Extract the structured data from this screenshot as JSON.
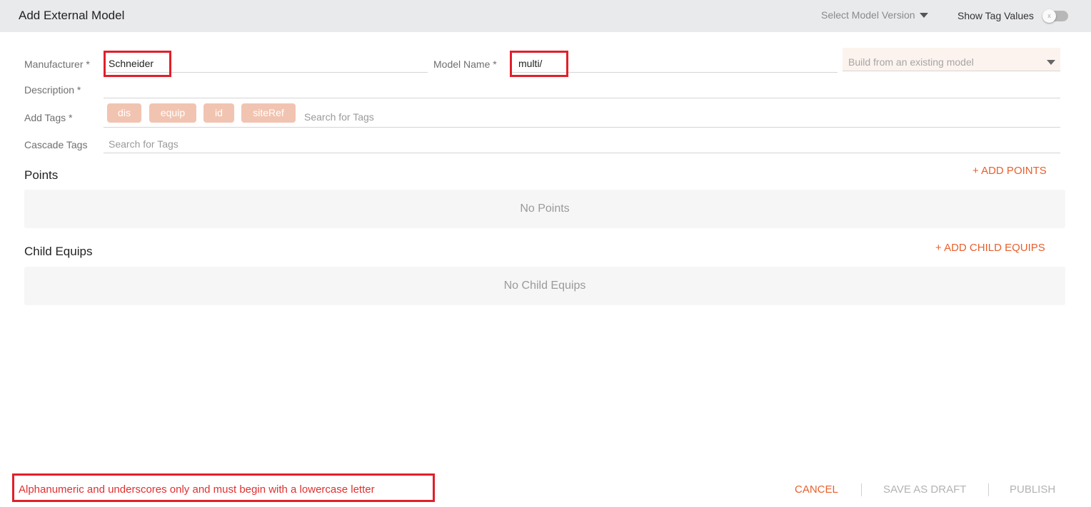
{
  "header": {
    "title": "Add External Model",
    "version_label": "Select Model Version",
    "show_tag_values_label": "Show Tag Values",
    "toggle_knob": "x"
  },
  "form": {
    "manufacturer_label": "Manufacturer *",
    "manufacturer_value": "Schneider",
    "model_name_label": "Model Name *",
    "model_name_value": "multi/",
    "build_from_placeholder": "Build from an existing model",
    "description_label": "Description *",
    "add_tags_label": "Add Tags *",
    "tags": [
      "dis",
      "equip",
      "id",
      "siteRef"
    ],
    "tag_search_placeholder": "Search for Tags",
    "cascade_tags_label": "Cascade Tags",
    "cascade_search_placeholder": "Search for Tags"
  },
  "points": {
    "title": "Points",
    "add_label": "+ ADD POINTS",
    "empty_text": "No Points"
  },
  "child_equips": {
    "title": "Child Equips",
    "add_label": "+ ADD CHILD EQUIPS",
    "empty_text": "No Child Equips"
  },
  "footer": {
    "error_text": "Alphanumeric and underscores only and must begin with a lowercase letter",
    "cancel_label": "CANCEL",
    "save_draft_label": "SAVE AS DRAFT",
    "publish_label": "PUBLISH"
  },
  "colors": {
    "accent": "#e8602d",
    "error": "#e03030",
    "chip_bg": "#f1c4b1",
    "header_bg": "#e9eaec"
  },
  "icons": {
    "version_dropdown": "caret-down-icon",
    "build_dropdown": "caret-down-icon"
  }
}
